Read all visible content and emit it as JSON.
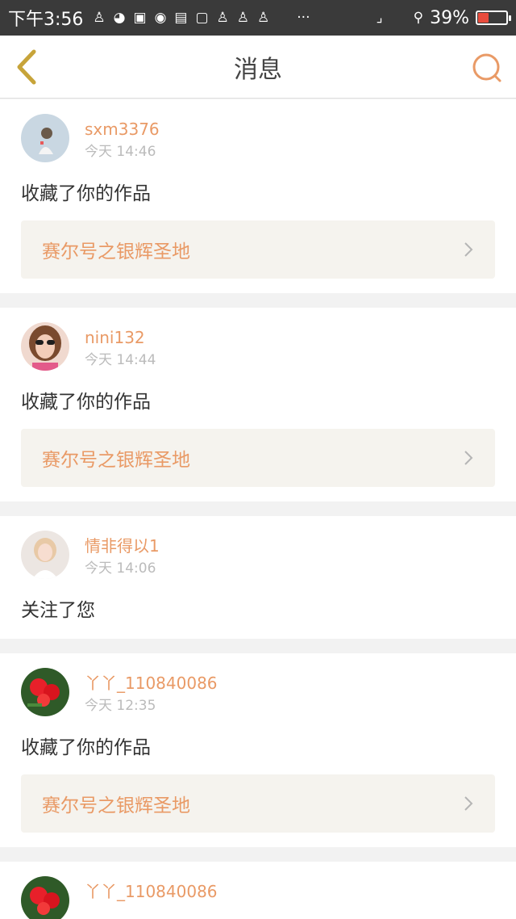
{
  "status_bar": {
    "time": "下午3:56",
    "battery_text": "39%",
    "battery_level": 0.39,
    "more_glyph": "···"
  },
  "header": {
    "title": "消息",
    "back_icon": "chevron-left-icon",
    "search_icon": "search-icon"
  },
  "colors": {
    "accent": "#e99a66",
    "back_arrow": "#c7a43a",
    "background": "#f2f2f2"
  },
  "messages": [
    {
      "username": "sxm3376",
      "time": "今天 14:46",
      "action": "收藏了你的作品",
      "work_title": "赛尔号之银辉圣地"
    },
    {
      "username": "nini132",
      "time": "今天 14:44",
      "action": "收藏了你的作品",
      "work_title": "赛尔号之银辉圣地"
    },
    {
      "username": "情非得以1",
      "time": "今天 14:06",
      "action": "关注了您"
    },
    {
      "username": "丫丫_110840086",
      "time": "今天 12:35",
      "action": "收藏了你的作品",
      "work_title": "赛尔号之银辉圣地"
    },
    {
      "username": "丫丫_110840086"
    }
  ]
}
